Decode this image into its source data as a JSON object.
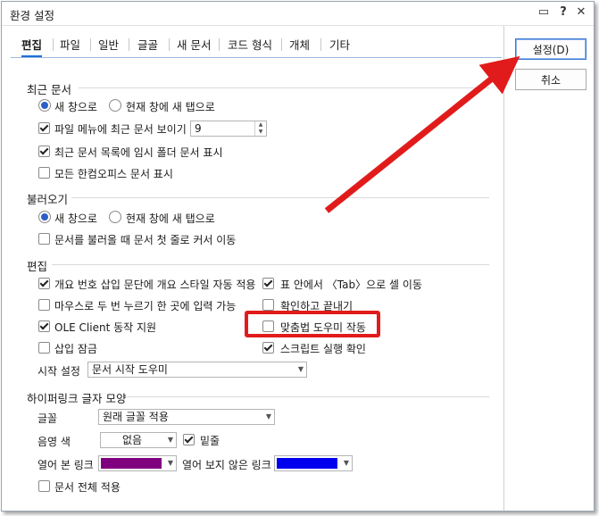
{
  "window": {
    "title": "환경 설정",
    "help_icon": "?",
    "close_icon": "✕"
  },
  "tabs": [
    "편집",
    "파일",
    "일반",
    "글골",
    "새 문서",
    "코드 형식",
    "개체",
    "기타"
  ],
  "buttons": {
    "ok": "설정(D)",
    "cancel": "취소"
  },
  "recent": {
    "header": "최근 문서",
    "radio1": "새 창으로",
    "radio2": "현재 창에 새 탭으로",
    "show_in_menu": "파일 메뉴에 최근 문서 보이기",
    "count": "9",
    "temp_folder": "최근 문서 목록에 임시 폴더 문서 표시",
    "all_hancom": "모든 한컴오피스 문서 표시"
  },
  "open": {
    "header": "불러오기",
    "radio1": "새 창으로",
    "radio2": "현재 창에 새 탭으로",
    "cursor_first_line": "문서를 불러올 때 문서 첫 줄로 커서 이동"
  },
  "edit": {
    "header": "편집",
    "auto_style": "개요 번호 삽입 문단에 개요 스타일 자동 적용",
    "tab_move": "표 안에서 〈Tab〉으로 셀 이동",
    "double_click": "마우스로 두 번 누르기 한 곳에 입력 가능",
    "confirm_close": "확인하고 끝내기",
    "ole": "OLE Client 동작 지원",
    "spell": "맞춤법 도우미 작동",
    "insert_lock": "삽입 잠금",
    "script_confirm": "스크립트 실행 확인",
    "startup_label": "시작 설정",
    "startup_value": "문서 시작 도우미"
  },
  "hyperlink": {
    "header": "하이퍼링크 글자 모양",
    "font_label": "글꼴",
    "font_value": "원래 글꼴 적용",
    "shade_label": "음영 색",
    "shade_value": "없음",
    "underline": "밑줄",
    "visited_label": "열어 본 링크",
    "visited_color": "#7f007f",
    "unvisited_label": "열어 보지 않은 링크",
    "unvisited_color": "#0000ee",
    "apply_all": "문서 전체 적용"
  },
  "annotation": {
    "color": "#e11b1b"
  }
}
